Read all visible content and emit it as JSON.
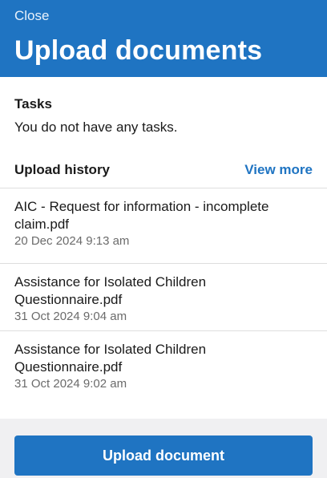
{
  "header": {
    "close_label": "Close",
    "title": "Upload documents"
  },
  "tasks": {
    "heading": "Tasks",
    "empty_message": "You do not have any tasks."
  },
  "upload_history": {
    "heading": "Upload history",
    "view_more_label": "View more",
    "items": [
      {
        "name": "AIC - Request for information - incomplete claim.pdf",
        "date": "20 Dec 2024 9:13 am"
      },
      {
        "name": "Assistance for Isolated Children Questionnaire.pdf",
        "date": "31 Oct 2024 9:04 am"
      },
      {
        "name": "Assistance for Isolated Children Questionnaire.pdf",
        "date": "31 Oct 2024 9:02 am"
      }
    ]
  },
  "footer": {
    "upload_button_label": "Upload document"
  },
  "colors": {
    "brand_blue": "#1f74c2",
    "secondary_text": "#6b6b6b"
  }
}
